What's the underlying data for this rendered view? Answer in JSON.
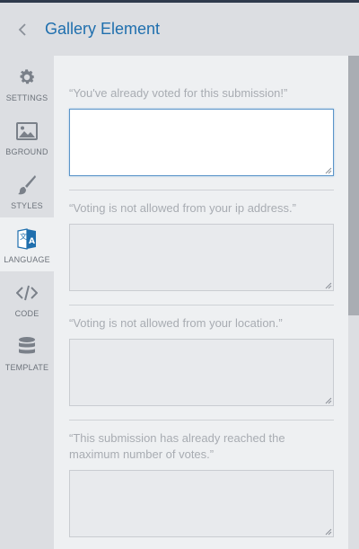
{
  "header": {
    "title": "Gallery Element"
  },
  "sidebar": {
    "items": [
      {
        "label": "SETTINGS",
        "icon": "gear-icon"
      },
      {
        "label": "BGROUND",
        "icon": "image-icon"
      },
      {
        "label": "STYLES",
        "icon": "brush-icon"
      },
      {
        "label": "LANGUAGE",
        "icon": "translate-icon",
        "active": true
      },
      {
        "label": "CODE",
        "icon": "code-icon"
      },
      {
        "label": "TEMPLATE",
        "icon": "database-icon"
      }
    ]
  },
  "fields": [
    {
      "label": "“You've already voted for this submission!”",
      "value": "",
      "focused": true
    },
    {
      "label": "“Voting is not allowed from your ip address.”",
      "value": ""
    },
    {
      "label": "“Voting is not allowed from your location.”",
      "value": ""
    },
    {
      "label": "“This submission has already reached the maximum number of votes.”",
      "value": ""
    }
  ],
  "colors": {
    "accent": "#1f6fae",
    "sidebar_bg": "#dcdee2",
    "content_bg": "#eef0f2",
    "focus_border": "#5b95c9"
  }
}
